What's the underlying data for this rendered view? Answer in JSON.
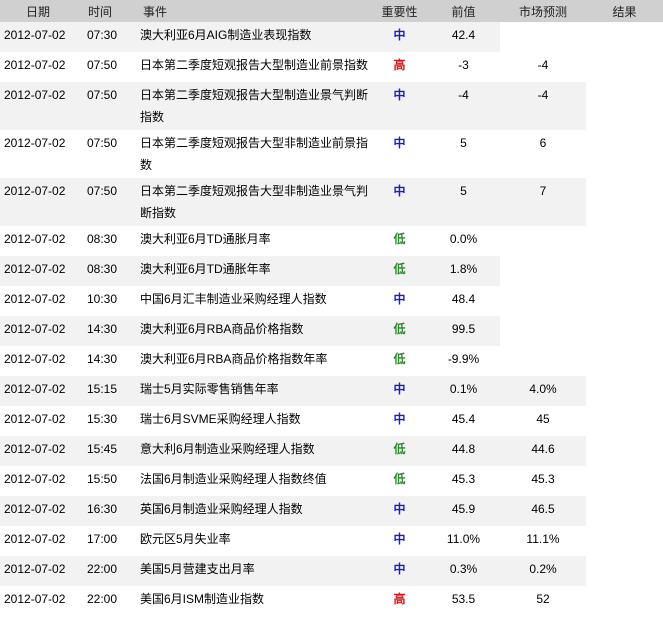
{
  "header": {
    "date": "日期",
    "time": "时间",
    "event": "事件",
    "importance": "重要性",
    "previous": "前值",
    "forecast": "市场预测",
    "actual": "结果"
  },
  "importance_colors": {
    "低": "#2a8a2a",
    "中": "#1a1adc",
    "高": "#d01818"
  },
  "rows": [
    {
      "date": "2012-07-02",
      "time": "07:30",
      "event": "澳大利亚6月AIG制造业表现指数",
      "importance": "中",
      "previous": "42.4",
      "forecast": "",
      "actual": ""
    },
    {
      "date": "2012-07-02",
      "time": "07:50",
      "event": "日本第二季度短观报告大型制造业前景指数",
      "importance": "高",
      "previous": "-3",
      "forecast": "-4",
      "actual": ""
    },
    {
      "date": "2012-07-02",
      "time": "07:50",
      "event": "日本第二季度短观报告大型制造业景气判断指数",
      "importance": "中",
      "previous": "-4",
      "forecast": "-4",
      "actual": ""
    },
    {
      "date": "2012-07-02",
      "time": "07:50",
      "event": "日本第二季度短观报告大型非制造业前景指数",
      "importance": "中",
      "previous": "5",
      "forecast": "6",
      "actual": ""
    },
    {
      "date": "2012-07-02",
      "time": "07:50",
      "event": "日本第二季度短观报告大型非制造业景气判断指数",
      "importance": "中",
      "previous": "5",
      "forecast": "7",
      "actual": ""
    },
    {
      "date": "2012-07-02",
      "time": "08:30",
      "event": "澳大利亚6月TD通胀月率",
      "importance": "低",
      "previous": "0.0%",
      "forecast": "",
      "actual": ""
    },
    {
      "date": "2012-07-02",
      "time": "08:30",
      "event": "澳大利亚6月TD通胀年率",
      "importance": "低",
      "previous": "1.8%",
      "forecast": "",
      "actual": ""
    },
    {
      "date": "2012-07-02",
      "time": "10:30",
      "event": "中国6月汇丰制造业采购经理人指数",
      "importance": "中",
      "previous": "48.4",
      "forecast": "",
      "actual": ""
    },
    {
      "date": "2012-07-02",
      "time": "14:30",
      "event": "澳大利亚6月RBA商品价格指数",
      "importance": "低",
      "previous": "99.5",
      "forecast": "",
      "actual": ""
    },
    {
      "date": "2012-07-02",
      "time": "14:30",
      "event": "澳大利亚6月RBA商品价格指数年率",
      "importance": "低",
      "previous": "-9.9%",
      "forecast": "",
      "actual": ""
    },
    {
      "date": "2012-07-02",
      "time": "15:15",
      "event": "瑞士5月实际零售销售年率",
      "importance": "中",
      "previous": "0.1%",
      "forecast": "4.0%",
      "actual": ""
    },
    {
      "date": "2012-07-02",
      "time": "15:30",
      "event": "瑞士6月SVME采购经理人指数",
      "importance": "中",
      "previous": "45.4",
      "forecast": "45",
      "actual": ""
    },
    {
      "date": "2012-07-02",
      "time": "15:45",
      "event": "意大利6月制造业采购经理人指数",
      "importance": "低",
      "previous": "44.8",
      "forecast": "44.6",
      "actual": ""
    },
    {
      "date": "2012-07-02",
      "time": "15:50",
      "event": "法国6月制造业采购经理人指数终值",
      "importance": "低",
      "previous": "45.3",
      "forecast": "45.3",
      "actual": ""
    },
    {
      "date": "2012-07-02",
      "time": "16:30",
      "event": "英国6月制造业采购经理人指数",
      "importance": "中",
      "previous": "45.9",
      "forecast": "46.5",
      "actual": ""
    },
    {
      "date": "2012-07-02",
      "time": "17:00",
      "event": "欧元区5月失业率",
      "importance": "中",
      "previous": "11.0%",
      "forecast": "11.1%",
      "actual": ""
    },
    {
      "date": "2012-07-02",
      "time": "22:00",
      "event": "美国5月营建支出月率",
      "importance": "中",
      "previous": "0.3%",
      "forecast": "0.2%",
      "actual": ""
    },
    {
      "date": "2012-07-02",
      "time": "22:00",
      "event": "美国6月ISM制造业指数",
      "importance": "高",
      "previous": "53.5",
      "forecast": "52",
      "actual": ""
    }
  ]
}
